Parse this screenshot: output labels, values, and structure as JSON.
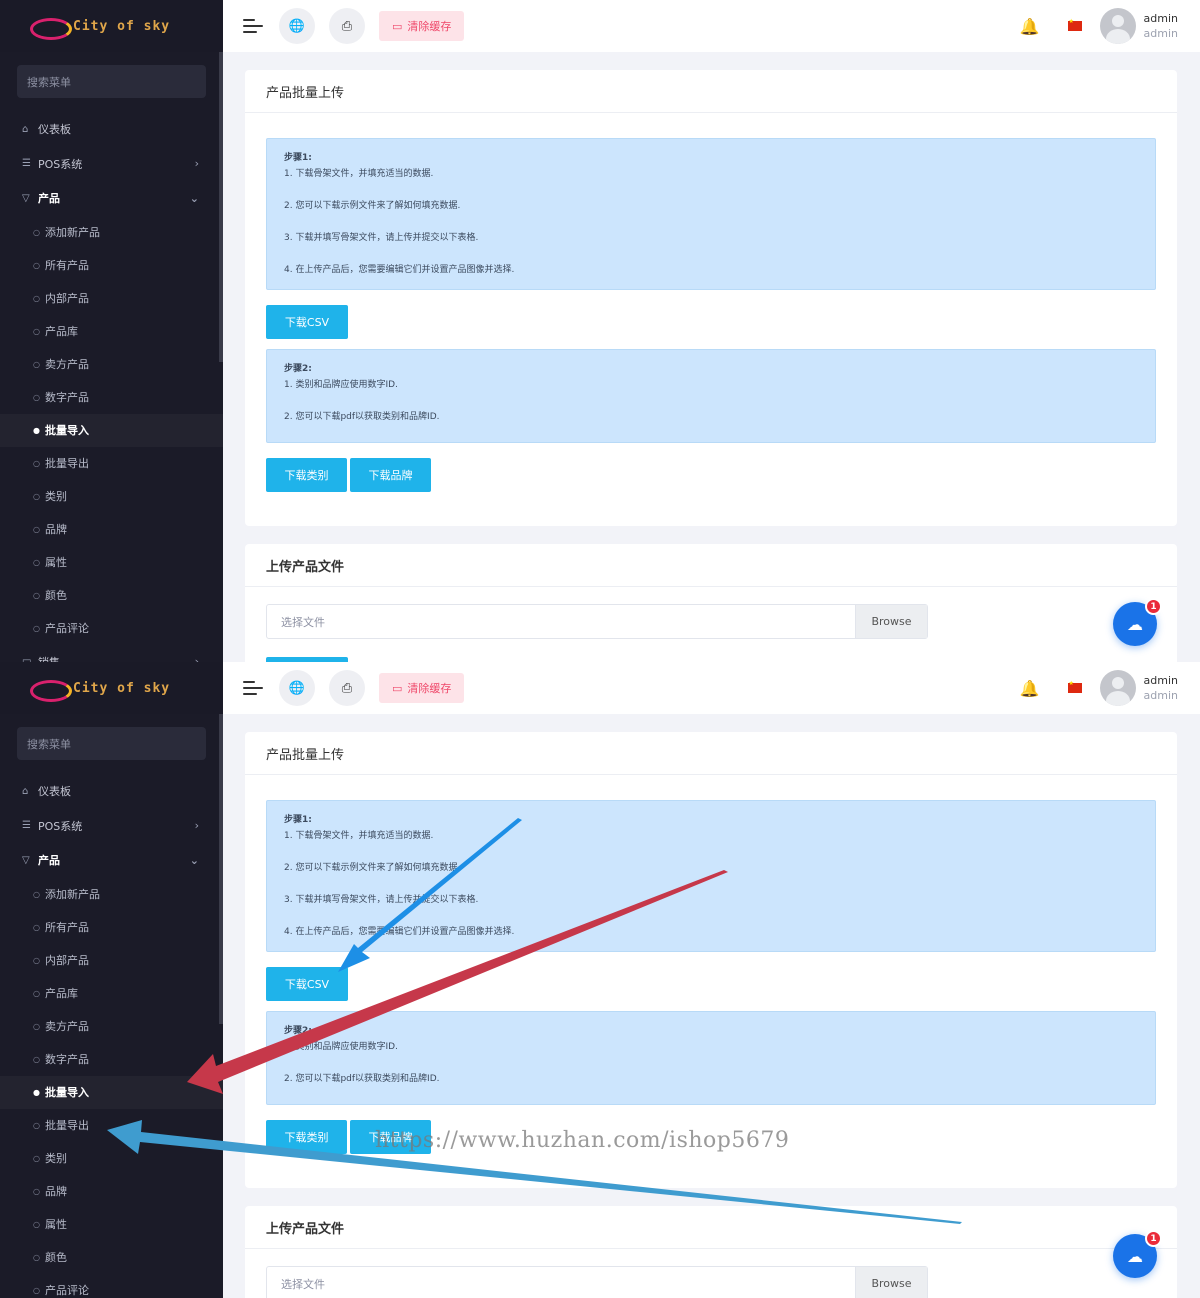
{
  "app": {
    "logo_text": "City of sky",
    "brand_colors": {
      "sidebar_bg": "#1b1b28",
      "accent_button": "#1fb3ea",
      "clear_cache_bg": "#fde3e8",
      "info_bg": "#cce5fd",
      "fab_bg": "#1a73e8",
      "badge": "#ea2b3a"
    }
  },
  "sidebar": {
    "search_placeholder": "搜索菜单",
    "items": [
      {
        "label": "仪表板",
        "icon": "home-icon"
      },
      {
        "label": "POS系统",
        "icon": "list-icon"
      },
      {
        "label": "产品",
        "icon": "cart-icon"
      }
    ],
    "sub_items": [
      "添加新产品",
      "所有产品",
      "内部产品",
      "产品库",
      "卖方产品",
      "数字产品",
      "批量导入",
      "批量导出",
      "类别",
      "品牌",
      "属性",
      "颜色",
      "产品评论"
    ],
    "active_sub": "批量导入",
    "cut_item": {
      "label": "销售",
      "icon": "sales-icon"
    }
  },
  "topbar": {
    "clear_cache": "清除缓存",
    "user_name": "admin",
    "user_role": "admin",
    "icons": [
      "menu-icon",
      "globe-icon",
      "printer-icon",
      "bell-icon",
      "flag-cn-icon"
    ]
  },
  "main": {
    "upload_card": {
      "title": "产品批量上传",
      "step1": {
        "title": "步骤1:",
        "lines": [
          "1. 下载骨架文件，并填充适当的数据.",
          "2. 您可以下载示例文件来了解如何填充数据.",
          "3. 下载并填写骨架文件，请上传并提交以下表格.",
          "4. 在上传产品后，您需要编辑它们并设置产品图像并选择."
        ]
      },
      "download_csv": "下载CSV",
      "step2": {
        "title": "步骤2:",
        "lines": [
          "1. 类别和品牌应使用数字ID.",
          "2. 您可以下载pdf以获取类别和品牌ID."
        ]
      },
      "download_category": "下载类别",
      "download_brand": "下载品牌"
    },
    "file_card": {
      "title": "上传产品文件",
      "placeholder": "选择文件",
      "browse": "Browse"
    },
    "fab_badge": "1"
  },
  "watermark": "https://www.huzhan.com/ishop5679"
}
